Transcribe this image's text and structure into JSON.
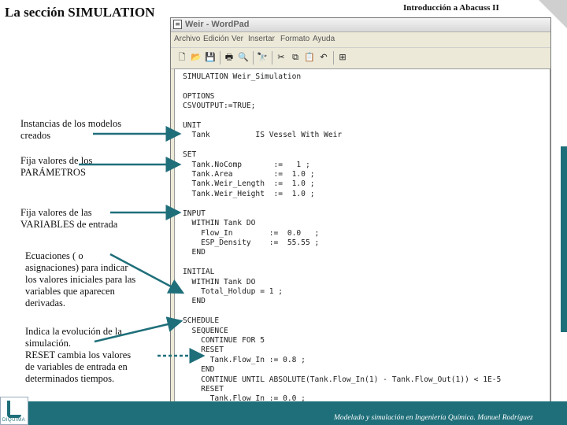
{
  "slide": {
    "title": "La sección SIMULATION",
    "header_right": "Introducción a Abacuss II",
    "footer": "Modelado y simulación en Ingeniería Química.  Manuel Rodríguez",
    "logo_text": "DIQUIMA"
  },
  "window": {
    "title": "Weir - WordPad",
    "menu": [
      "Archivo",
      "Edición",
      "Ver",
      "Insertar",
      "Formato",
      "Ayuda"
    ],
    "toolbar": [
      {
        "icon": "new-document-icon",
        "glyph": "🗋"
      },
      {
        "icon": "open-folder-icon",
        "glyph": "📂"
      },
      {
        "icon": "save-icon",
        "glyph": "💾"
      },
      {
        "icon": "print-icon",
        "glyph": "🖶"
      },
      {
        "icon": "print-preview-icon",
        "glyph": "🔍"
      },
      {
        "icon": "find-icon",
        "glyph": "🔭"
      },
      {
        "icon": "cut-icon",
        "glyph": "✂"
      },
      {
        "icon": "copy-icon",
        "glyph": "⧉"
      },
      {
        "icon": "paste-icon",
        "glyph": "📋"
      },
      {
        "icon": "undo-icon",
        "glyph": "↶"
      },
      {
        "icon": "insert-object-icon",
        "glyph": "⊞"
      }
    ]
  },
  "code_lines": [
    "SIMULATION Weir_Simulation",
    "",
    "OPTIONS",
    "CSVOUTPUT:=TRUE;",
    "",
    "UNIT",
    "  Tank          IS Vessel With Weir",
    "",
    "SET",
    "  Tank.NoComp       :=   1 ;",
    "  Tank.Area         :=  1.0 ;",
    "  Tank.Weir_Length  :=  1.0 ;",
    "  Tank.Weir_Height  :=  1.0 ;",
    "",
    "INPUT",
    "  WITHIN Tank DO",
    "    Flow_In        :=  0.0   ;",
    "    ESP_Density    :=  55.55 ;",
    "  END",
    "",
    "INITIAL",
    "  WITHIN Tank DO",
    "    Total_Holdup = 1 ;",
    "  END",
    "",
    "SCHEDULE",
    "  SEQUENCE",
    "    CONTINUE FOR 5",
    "    RESET",
    "      Tank.Flow_In := 0.8 ;",
    "    END",
    "    CONTINUE UNTIL ABSOLUTE(Tank.Flow_In(1) - Tank.Flow_Out(1)) < 1E-5",
    "    RESET",
    "      Tank.Flow_In := 0.0 ;"
  ],
  "annotations": [
    {
      "lines": [
        "Instancias de los modelos",
        "creados"
      ]
    },
    {
      "lines": [
        "Fija valores de los",
        "PARÁMETROS"
      ]
    },
    {
      "lines": [
        "Fija valores de las",
        "VARIABLES de entrada"
      ]
    },
    {
      "lines": [
        "Ecuaciones ( o",
        "asignaciones) para indicar",
        "los valores iniciales para las",
        "variables que aparecen",
        "derivadas."
      ]
    },
    {
      "lines": [
        "Indica la evolución de la",
        "simulación.",
        "RESET cambia los valores",
        "de variables de entrada en",
        "determinados tiempos."
      ]
    }
  ],
  "colors": {
    "accent": "#1f6f7a",
    "arrow": "#1f6f7a"
  }
}
